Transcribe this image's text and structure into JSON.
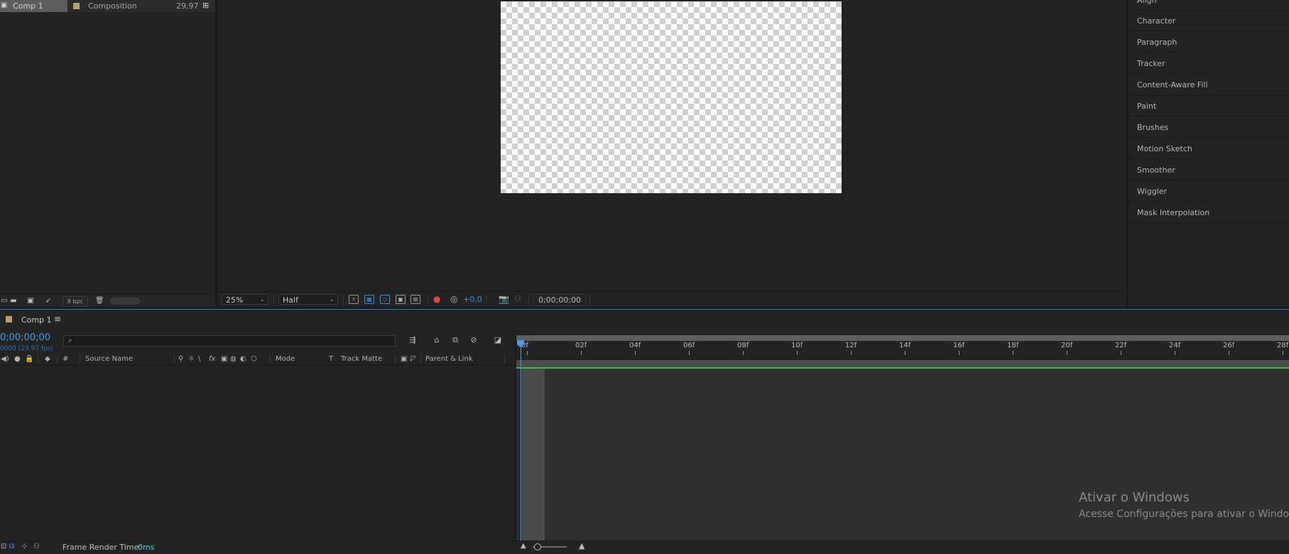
{
  "project": {
    "item_name": "Comp 1",
    "item_type": "Composition",
    "item_fps": "29,97",
    "bpc_label": "8 bpc"
  },
  "viewer": {
    "zoom": "25%",
    "resolution": "Half",
    "exposure": "+0,0",
    "timecode": "0;00;00;00"
  },
  "right_panel": {
    "items": [
      "Align",
      "Character",
      "Paragraph",
      "Tracker",
      "Content-Aware Fill",
      "Paint",
      "Brushes",
      "Motion Sketch",
      "Smoother",
      "Wiggler",
      "Mask Interpolation"
    ]
  },
  "timeline": {
    "tab_label": "Comp 1",
    "timecode": "0;00;00;00",
    "frames": "0000 (29.97 fps)",
    "columns": {
      "hash": "#",
      "source_name": "Source Name",
      "mode": "Mode",
      "t": "T",
      "track_matte": "Track Matte",
      "parent": "Parent & Link"
    },
    "ruler_ticks": [
      "0f",
      "02f",
      "04f",
      "06f",
      "08f",
      "10f",
      "12f",
      "14f",
      "16f",
      "18f",
      "20f",
      "22f",
      "24f",
      "26f",
      "28f"
    ],
    "render_label": "Frame Render Time:",
    "render_value": "0ms",
    "accent_color": "#4a9be8",
    "work_area_color": "#39c147"
  },
  "watermark": {
    "title": "Ativar o Windows",
    "subtitle": "Acesse Configurações para ativar o Windows."
  }
}
